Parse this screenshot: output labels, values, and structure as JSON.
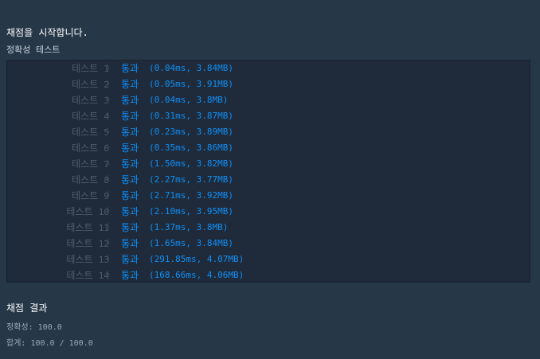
{
  "console": {
    "start_message": "채점을 시작합니다.",
    "section_label": "정확성  테스트",
    "tests": [
      {
        "name": "테스트",
        "number": "1",
        "status": "통과",
        "detail": "(0.04ms, 3.84MB)"
      },
      {
        "name": "테스트",
        "number": "2",
        "status": "통과",
        "detail": "(0.05ms, 3.91MB)"
      },
      {
        "name": "테스트",
        "number": "3",
        "status": "통과",
        "detail": "(0.04ms, 3.8MB)"
      },
      {
        "name": "테스트",
        "number": "4",
        "status": "통과",
        "detail": "(0.31ms, 3.87MB)"
      },
      {
        "name": "테스트",
        "number": "5",
        "status": "통과",
        "detail": "(0.23ms, 3.89MB)"
      },
      {
        "name": "테스트",
        "number": "6",
        "status": "통과",
        "detail": "(0.35ms, 3.86MB)"
      },
      {
        "name": "테스트",
        "number": "7",
        "status": "통과",
        "detail": "(1.50ms, 3.82MB)"
      },
      {
        "name": "테스트",
        "number": "8",
        "status": "통과",
        "detail": "(2.27ms, 3.77MB)"
      },
      {
        "name": "테스트",
        "number": "9",
        "status": "통과",
        "detail": "(2.71ms, 3.92MB)"
      },
      {
        "name": "테스트",
        "number": "10",
        "status": "통과",
        "detail": "(2.10ms, 3.95MB)"
      },
      {
        "name": "테스트",
        "number": "11",
        "status": "통과",
        "detail": "(1.37ms, 3.8MB)"
      },
      {
        "name": "테스트",
        "number": "12",
        "status": "통과",
        "detail": "(1.65ms, 3.84MB)"
      },
      {
        "name": "테스트",
        "number": "13",
        "status": "통과",
        "detail": "(291.85ms, 4.07MB)"
      },
      {
        "name": "테스트",
        "number": "14",
        "status": "통과",
        "detail": "(168.66ms, 4.06MB)"
      }
    ],
    "result_title": "채점 결과",
    "accuracy_label": "정확성:",
    "accuracy_value": "100.0",
    "total_label": "합계:",
    "total_value": "100.0 / 100.0",
    "colors": {
      "background": "#263747",
      "box": "#1f2b3a",
      "pass": "#0f8ff7",
      "muted": "#4f5d6b"
    }
  }
}
